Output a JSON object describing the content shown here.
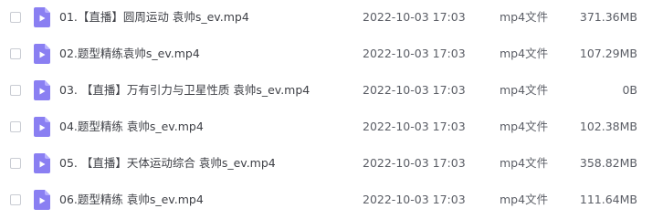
{
  "files": [
    {
      "name": "01.【直播】圆周运动 袁帅s_ev.mp4",
      "date": "2022-10-03 17:03",
      "type": "mp4文件",
      "size": "371.36MB"
    },
    {
      "name": "02.题型精练袁帅s_ev.mp4",
      "date": "2022-10-03 17:03",
      "type": "mp4文件",
      "size": "107.29MB"
    },
    {
      "name": "03. 【直播】万有引力与卫星性质 袁帅s_ev.mp4",
      "date": "2022-10-03 17:03",
      "type": "mp4文件",
      "size": "0B"
    },
    {
      "name": "04.题型精练 袁帅s_ev.mp4",
      "date": "2022-10-03 17:03",
      "type": "mp4文件",
      "size": "102.38MB"
    },
    {
      "name": "05. 【直播】天体运动综合 袁帅s_ev.mp4",
      "date": "2022-10-03 17:03",
      "type": "mp4文件",
      "size": "358.82MB"
    },
    {
      "name": "06.题型精练  袁帅s_ev.mp4",
      "date": "2022-10-03 17:03",
      "type": "mp4文件",
      "size": "111.64MB"
    }
  ],
  "icon": {
    "name": "video-file-icon",
    "color": "#8a7ff2"
  }
}
